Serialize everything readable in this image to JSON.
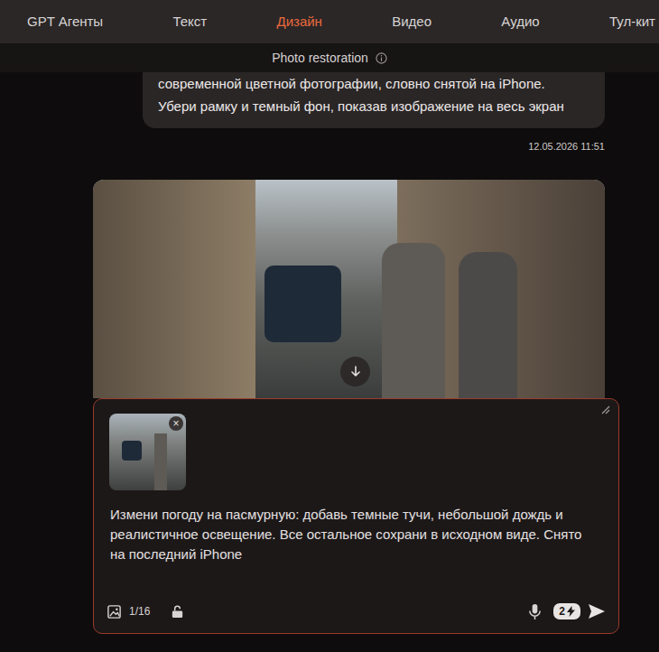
{
  "nav": {
    "tabs": [
      {
        "label": "GPT Агенты",
        "selected": false
      },
      {
        "label": "Текст",
        "selected": false
      },
      {
        "label": "Дизайн",
        "selected": true
      },
      {
        "label": "Видео",
        "selected": false
      },
      {
        "label": "Аудио",
        "selected": false
      },
      {
        "label": "Тул-кит",
        "selected": false
      }
    ]
  },
  "header": {
    "title": "Photo restoration"
  },
  "message": {
    "lines": [
      "современной цветной фотографии, словно снятой на iPhone.",
      "Убери рамку и темный фон, показав изображение на весь экран"
    ],
    "time": "12.05.2026 11:51"
  },
  "composer": {
    "attachment_close": "×",
    "lines": [
      "Измени погоду на пасмурную: добавь темные тучи, небольшой дождь и",
      "реалистичное освещение. Все остальное сохрани в исходном виде. Снято",
      "на последний iPhone"
    ],
    "attachments_count": "1/16",
    "cost": "2"
  }
}
